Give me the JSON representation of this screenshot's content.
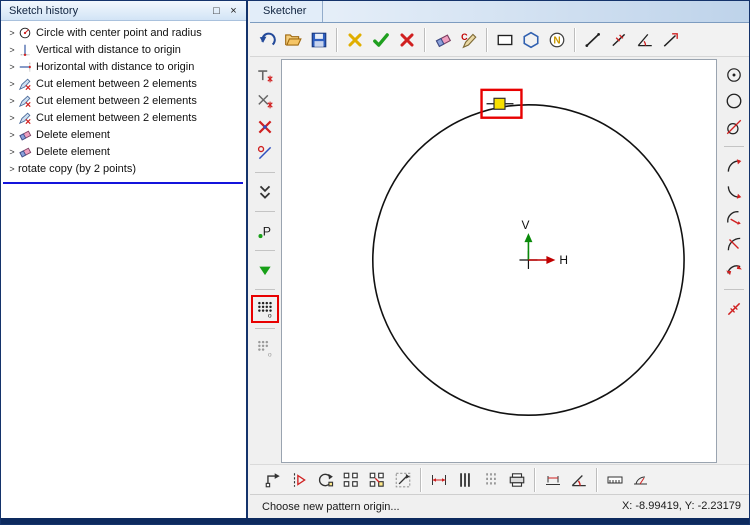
{
  "left_panel": {
    "title": "Sketch history",
    "maximize_glyph": "□",
    "close_glyph": "×",
    "items": [
      {
        "label": "Circle with center point and radius",
        "icon": "h-circle"
      },
      {
        "label": "Vertical with distance to origin",
        "icon": "h-vert"
      },
      {
        "label": "Horizontal with distance to origin",
        "icon": "h-horiz"
      },
      {
        "label": "Cut element between 2 elements",
        "icon": "h-cut"
      },
      {
        "label": "Cut element between 2 elements",
        "icon": "h-cut"
      },
      {
        "label": "Cut element between 2 elements",
        "icon": "h-cut"
      },
      {
        "label": "Delete element",
        "icon": "h-del"
      },
      {
        "label": "Delete element",
        "icon": "h-del"
      },
      {
        "label": "rotate copy (by 2 points)",
        "icon": null
      }
    ]
  },
  "sketcher": {
    "tab_title": "Sketcher",
    "top_toolbar": {
      "groups": [
        [
          "undo",
          "open",
          "save"
        ],
        [
          "discard",
          "accept",
          "cancel"
        ],
        [
          "eraser",
          "copy-format"
        ],
        [
          "rectangle-tool",
          "polygon-tool",
          "ngon-tool"
        ],
        [
          "line-tool",
          "line-divide-tool",
          "angle-line-tool",
          "line-extend-tool"
        ]
      ]
    },
    "left_toolbar": {
      "groups": [
        [
          "point-tangent",
          "point-intersect",
          "point-delete",
          "point-project"
        ],
        [
          "collapse-chevrons"
        ],
        [
          "param-point"
        ],
        [
          "apply-triangle"
        ],
        [
          "pattern-linear"
        ],
        [
          "pattern-circular"
        ]
      ]
    },
    "right_toolbar": {
      "groups": [
        [
          "circle-center",
          "circle-plain",
          "circle-tangent"
        ],
        [
          "arc-sweep",
          "arc-chord",
          "arc-radius",
          "arc-diameter",
          "arc-double"
        ],
        [
          "angle-red"
        ]
      ]
    },
    "bottom_toolbar": {
      "groups": [
        [
          "transform-move",
          "transform-mirror",
          "transform-rotate",
          "pattern-rect",
          "pattern-copy",
          "transform-scale"
        ],
        [
          "dim-distance",
          "dim-parallel",
          "dim-dashed",
          "dim-stack"
        ],
        [
          "dim-horizontal",
          "dim-angle"
        ],
        [
          "measure-distance",
          "measure-angle"
        ]
      ]
    },
    "canvas": {
      "v_axis_label": "V",
      "h_axis_label": "H"
    },
    "status_bar": {
      "message": "Choose new pattern origin...",
      "coordinates": "X: -8.99419, Y: -2.23179"
    }
  },
  "colors": {
    "highlight_red": "#e80000",
    "marker_yellow": "#f8e000",
    "axis_v_green": "#0a8a0a",
    "axis_h_red": "#c00000",
    "history_divider_blue": "#1414dc",
    "window_frame_navy": "#14336b"
  }
}
